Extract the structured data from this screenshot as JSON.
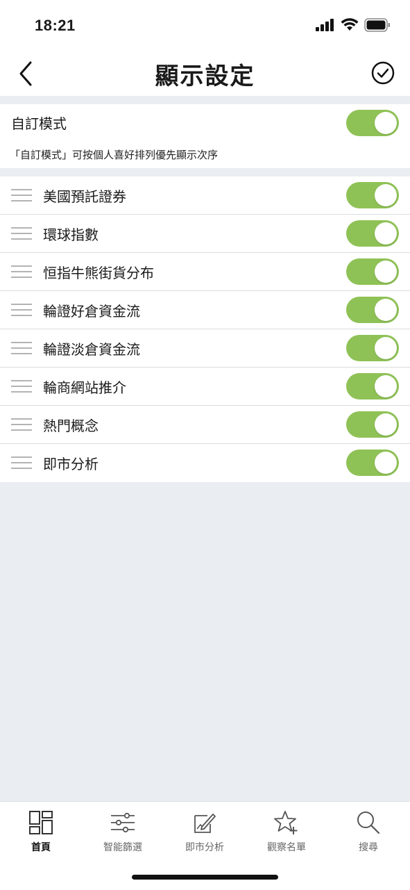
{
  "status_bar": {
    "time": "18:21"
  },
  "header": {
    "title": "顯示設定",
    "back_icon": "chevron-left-icon",
    "confirm_icon": "check-circle-icon"
  },
  "custom_mode": {
    "label": "自訂模式",
    "description": "「自訂模式」可按個人喜好排列優先顯示次序",
    "enabled": true
  },
  "sections": [
    {
      "label": "美國預託證券",
      "enabled": true
    },
    {
      "label": "環球指數",
      "enabled": true
    },
    {
      "label": "恒指牛熊街貨分布",
      "enabled": true
    },
    {
      "label": "輪證好倉資金流",
      "enabled": true
    },
    {
      "label": "輪證淡倉資金流",
      "enabled": true
    },
    {
      "label": "輪商網站推介",
      "enabled": true
    },
    {
      "label": "熱門概念",
      "enabled": true
    },
    {
      "label": "即市分析",
      "enabled": true
    }
  ],
  "tabs": [
    {
      "label": "首頁",
      "icon": "home-grid-icon",
      "active": true
    },
    {
      "label": "智能篩選",
      "icon": "sliders-icon",
      "active": false
    },
    {
      "label": "即市分析",
      "icon": "edit-chart-icon",
      "active": false
    },
    {
      "label": "觀察名單",
      "icon": "star-plus-icon",
      "active": false
    },
    {
      "label": "搜尋",
      "icon": "search-icon",
      "active": false
    }
  ],
  "colors": {
    "toggle_on": "#8fc256",
    "background": "#eaedf1"
  }
}
